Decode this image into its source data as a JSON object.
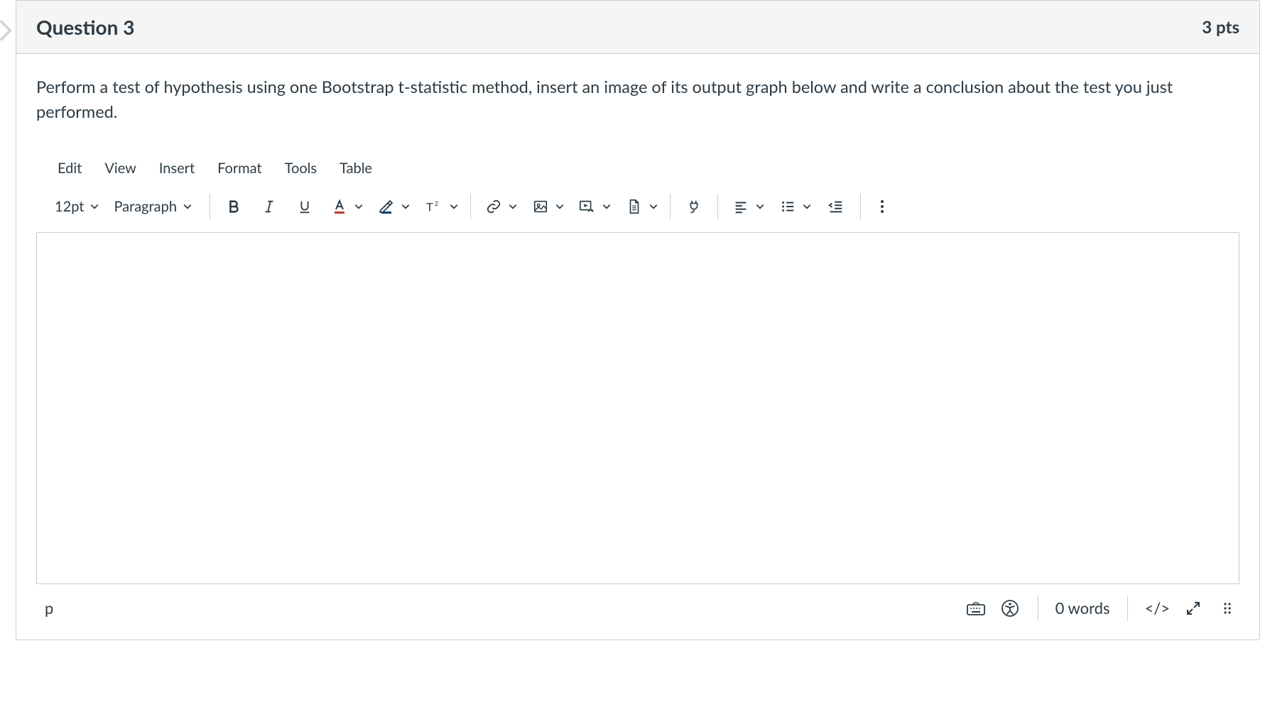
{
  "header": {
    "title": "Question 3",
    "points": "3 pts"
  },
  "prompt": "Perform a test of hypothesis using one Bootstrap t-statistic method, insert an image of its output graph below and write a conclusion about the test you just performed.",
  "menubar": {
    "items": [
      "Edit",
      "View",
      "Insert",
      "Format",
      "Tools",
      "Table"
    ]
  },
  "toolbar": {
    "font_size": "12pt",
    "block_format": "Paragraph"
  },
  "statusbar": {
    "element_path": "p",
    "word_count": "0 words",
    "html_label": "</>"
  }
}
